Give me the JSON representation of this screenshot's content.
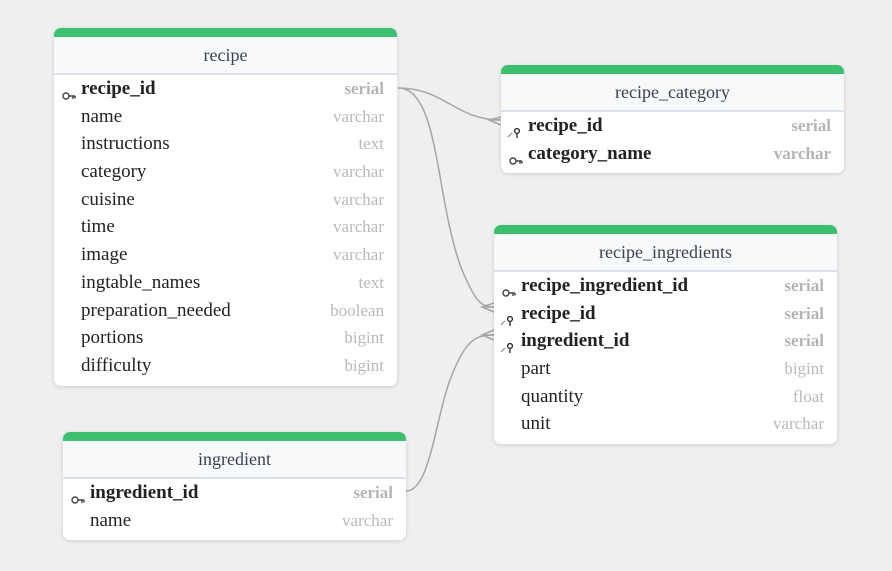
{
  "colors": {
    "header_bar": "#3cbf6e",
    "relation_line": "#a6a6a6"
  },
  "tables": {
    "recipe": {
      "title": "recipe",
      "columns": [
        {
          "name": "recipe_id",
          "type": "serial",
          "key": "primary"
        },
        {
          "name": "name",
          "type": "varchar",
          "key": "none"
        },
        {
          "name": "instructions",
          "type": "text",
          "key": "none"
        },
        {
          "name": "category",
          "type": "varchar",
          "key": "none"
        },
        {
          "name": "cuisine",
          "type": "varchar",
          "key": "none"
        },
        {
          "name": "time",
          "type": "varchar",
          "key": "none"
        },
        {
          "name": "image",
          "type": "varchar",
          "key": "none"
        },
        {
          "name": "ingtable_names",
          "type": "text",
          "key": "none"
        },
        {
          "name": "preparation_needed",
          "type": "boolean",
          "key": "none"
        },
        {
          "name": "portions",
          "type": "bigint",
          "key": "none"
        },
        {
          "name": "difficulty",
          "type": "bigint",
          "key": "none"
        }
      ]
    },
    "recipe_category": {
      "title": "recipe_category",
      "columns": [
        {
          "name": "recipe_id",
          "type": "serial",
          "key": "primary-foreign"
        },
        {
          "name": "category_name",
          "type": "varchar",
          "key": "primary"
        }
      ]
    },
    "recipe_ingredients": {
      "title": "recipe_ingredients",
      "columns": [
        {
          "name": "recipe_ingredient_id",
          "type": "serial",
          "key": "primary"
        },
        {
          "name": "recipe_id",
          "type": "serial",
          "key": "foreign"
        },
        {
          "name": "ingredient_id",
          "type": "serial",
          "key": "foreign"
        },
        {
          "name": "part",
          "type": "bigint",
          "key": "none"
        },
        {
          "name": "quantity",
          "type": "float",
          "key": "none"
        },
        {
          "name": "unit",
          "type": "varchar",
          "key": "none"
        }
      ]
    },
    "ingredient": {
      "title": "ingredient",
      "columns": [
        {
          "name": "ingredient_id",
          "type": "serial",
          "key": "primary"
        },
        {
          "name": "name",
          "type": "varchar",
          "key": "none"
        }
      ]
    }
  },
  "relations": [
    {
      "from": "recipe.recipe_id",
      "to": "recipe_category.recipe_id",
      "cardinality": "one-to-many"
    },
    {
      "from": "recipe.recipe_id",
      "to": "recipe_ingredients.recipe_id",
      "cardinality": "one-to-many"
    },
    {
      "from": "ingredient.ingredient_id",
      "to": "recipe_ingredients.ingredient_id",
      "cardinality": "one-to-many"
    }
  ]
}
